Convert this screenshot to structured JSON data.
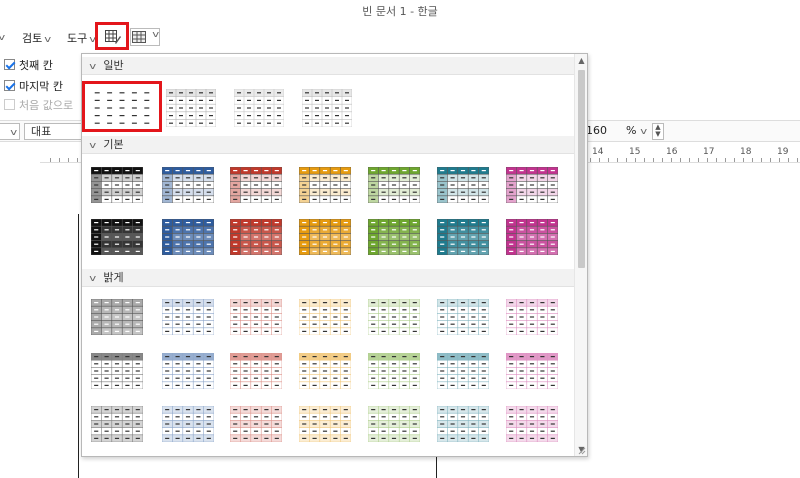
{
  "window": {
    "title": "빈 문서 1 - 한글"
  },
  "menu": {
    "review_label": "검토",
    "tools_label": "도구"
  },
  "options": {
    "first_col_label": "첫째 칸",
    "last_col_label": "마지막 칸",
    "first_col_checked": true,
    "last_col_checked": true,
    "reset_label": "처음 값으로"
  },
  "style_bar": {
    "style_value": "대표",
    "zoom_value": "160",
    "zoom_unit": "%"
  },
  "ruler": {
    "numbers": [
      "14",
      "15",
      "16",
      "17",
      "18",
      "19"
    ]
  },
  "gallery": {
    "sections": [
      {
        "title": "일반"
      },
      {
        "title": "기본"
      },
      {
        "title": "밝게"
      }
    ],
    "selected_style_index": 0,
    "colors": {
      "black": "#111111",
      "blue": "#2e5c9e",
      "red": "#c0392b",
      "orange": "#e69b10",
      "green": "#6ea72f",
      "teal": "#1f7b8e",
      "pink": "#c2338f"
    }
  },
  "colors": {
    "accent_highlight": "#e3161b",
    "checkbox": "#1a73e8"
  }
}
